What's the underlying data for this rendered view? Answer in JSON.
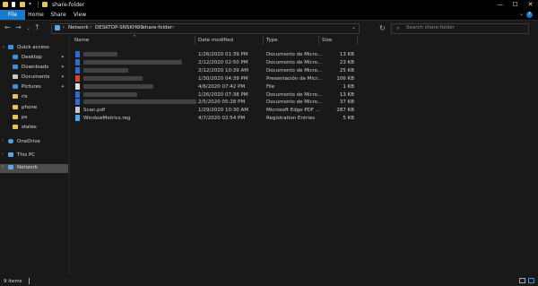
{
  "window": {
    "title": "share-folder",
    "controls": [
      "—",
      "☐",
      "✕"
    ]
  },
  "ribbon": {
    "tabs": [
      "File",
      "Home",
      "Share",
      "View"
    ],
    "help": "?"
  },
  "address": {
    "crumbs": [
      "Network",
      "DESKTOP-SNSKHO9",
      "share-folder"
    ],
    "search_placeholder": "Search share-folder"
  },
  "nav": {
    "items": [
      {
        "label": "Quick access",
        "color": "#3d8ee6",
        "pinned": false
      },
      {
        "label": "Desktop",
        "color": "#3f8fd8",
        "pinned": true
      },
      {
        "label": "Downloads",
        "color": "#3f8fd8",
        "pinned": true
      },
      {
        "label": "Documents",
        "color": "#c9c9c9",
        "pinned": true
      },
      {
        "label": "Pictures",
        "color": "#3f8fd8",
        "pinned": true
      },
      {
        "label": "ris",
        "color": "#e8c35a",
        "pinned": false
      },
      {
        "label": "phone",
        "color": "#e8c35a",
        "pinned": false
      },
      {
        "label": "ps",
        "color": "#e8c35a",
        "pinned": false
      },
      {
        "label": "states",
        "color": "#e8c35a",
        "pinned": false
      },
      {
        "label": "OneDrive",
        "color": "#4aa3ef",
        "pinned": false
      },
      {
        "label": "This PC",
        "color": "#5aa7e8",
        "pinned": false
      },
      {
        "label": "Network",
        "color": "#5aa7e8",
        "pinned": false
      }
    ]
  },
  "columns": [
    "Name",
    "Date modified",
    "Type",
    "Size"
  ],
  "files": [
    {
      "name": "",
      "date": "1/26/2020 01:39 PM",
      "type": "Documento de Micro...",
      "size": "13 KB",
      "icon": "#2f6bd1"
    },
    {
      "name": "",
      "date": "2/12/2020 02:50 PM",
      "type": "Documento de Micro...",
      "size": "23 KB",
      "icon": "#2f6bd1"
    },
    {
      "name": "",
      "date": "2/12/2020 10:39 AM",
      "type": "Documento de Micro...",
      "size": "25 KB",
      "icon": "#2f6bd1"
    },
    {
      "name": "",
      "date": "1/30/2020 04:39 PM",
      "type": "Presentación de Micr...",
      "size": "106 KB",
      "icon": "#d24726"
    },
    {
      "name": "",
      "date": "4/6/2020 07:42 PM",
      "type": "File",
      "size": "1 KB",
      "icon": "#e0e0e0"
    },
    {
      "name": "",
      "date": "1/26/2020 07:38 PM",
      "type": "Documento de Micro...",
      "size": "13 KB",
      "icon": "#2f6bd1"
    },
    {
      "name": "",
      "date": "2/5/2020 05:28 PM",
      "type": "Documento de Micro...",
      "size": "37 KB",
      "icon": "#2f6bd1"
    },
    {
      "name": "Scan.pdf",
      "date": "1/29/2020 10:30 AM",
      "type": "Microsoft Edge PDF ...",
      "size": "287 KB",
      "icon": "#c8c8c8"
    },
    {
      "name": "WindowMetrics.reg",
      "date": "4/7/2020 02:54 PM",
      "type": "Registration Entries",
      "size": "5 KB",
      "icon": "#5aa7e8"
    }
  ],
  "status": {
    "items": "9 items"
  }
}
